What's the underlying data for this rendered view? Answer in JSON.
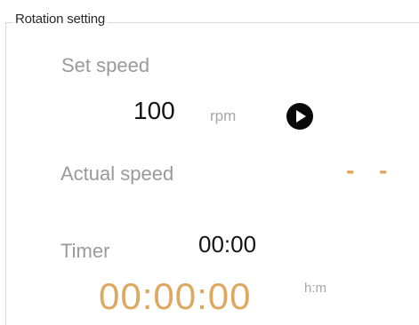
{
  "group": {
    "title": "Rotation setting"
  },
  "set_speed": {
    "label": "Set speed",
    "value": "100",
    "unit": "rpm",
    "play_icon": "play-circle-icon"
  },
  "actual_speed": {
    "label": "Actual speed",
    "value": "- -"
  },
  "timer": {
    "label": "Timer",
    "value": "00:00",
    "countdown": "00:00:00",
    "unit": "h:m"
  },
  "colors": {
    "accent_orange": "#dfa860",
    "label_gray": "#9a9a9a",
    "value_dark": "#141414"
  }
}
